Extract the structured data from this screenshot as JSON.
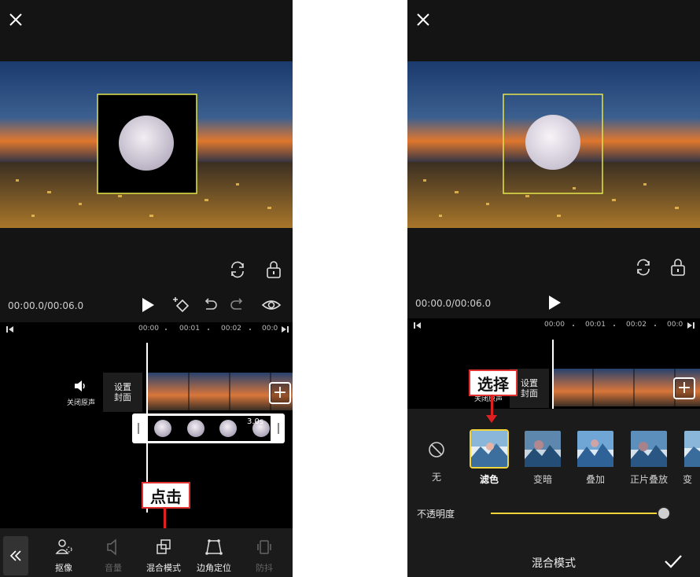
{
  "left": {
    "timecode": "00:00.0/00:06.0",
    "ruler_ticks": [
      "00:00",
      "00:01",
      "00:02",
      "00:0"
    ],
    "mute_label": "关闭原声",
    "cover_label": "设置\n封面",
    "clip_duration": "3.0s",
    "callout": "点击",
    "toolbar": [
      {
        "name": "cutout",
        "label": "抠像",
        "enabled": true
      },
      {
        "name": "volume",
        "label": "音量",
        "enabled": false
      },
      {
        "name": "blend-mode",
        "label": "混合模式",
        "enabled": true
      },
      {
        "name": "corner-pin",
        "label": "边角定位",
        "enabled": true
      },
      {
        "name": "stabilize",
        "label": "防抖",
        "enabled": false
      }
    ]
  },
  "right": {
    "timecode": "00:00.0/00:06.0",
    "ruler_ticks": [
      "00:00",
      "00:01",
      "00:02",
      "00:0"
    ],
    "mute_label": "关闭原声",
    "cover_label": "设置\n封面",
    "callout": "选择",
    "blend_modes": [
      {
        "label": "无",
        "selected": false
      },
      {
        "label": "滤色",
        "selected": true
      },
      {
        "label": "变暗",
        "selected": false
      },
      {
        "label": "叠加",
        "selected": false
      },
      {
        "label": "正片叠放",
        "selected": false
      },
      {
        "label": "变",
        "selected": false
      }
    ],
    "opacity_label": "不透明度",
    "opacity_value": 1.0,
    "panel_title": "混合模式"
  },
  "colors": {
    "selection_yellow": "#f2d43b",
    "callout_red": "#e02020"
  }
}
